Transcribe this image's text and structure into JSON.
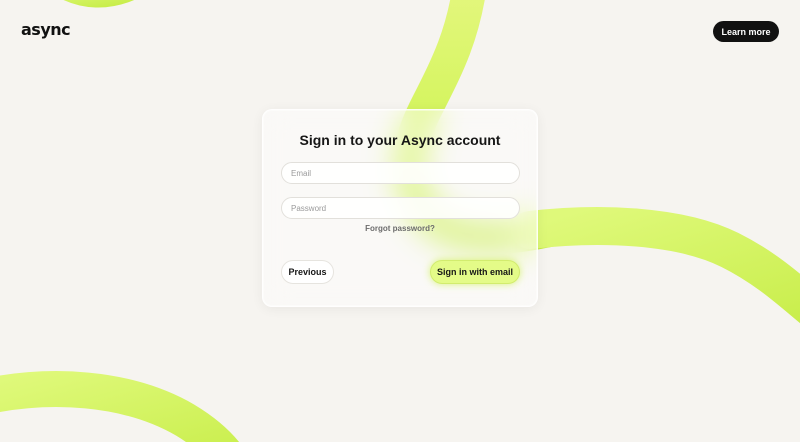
{
  "app": {
    "logo_text": "async"
  },
  "header": {
    "learn_more_label": "Learn more"
  },
  "signin": {
    "title": "Sign in to your Async account",
    "email_placeholder": "Email",
    "password_placeholder": "Password",
    "forgot_password_label": "Forgot password?",
    "previous_label": "Previous",
    "submit_label": "Sign in with email"
  },
  "theme": {
    "background": "#f6f4f0",
    "accent": "#d6f76a",
    "dark": "#111111"
  }
}
